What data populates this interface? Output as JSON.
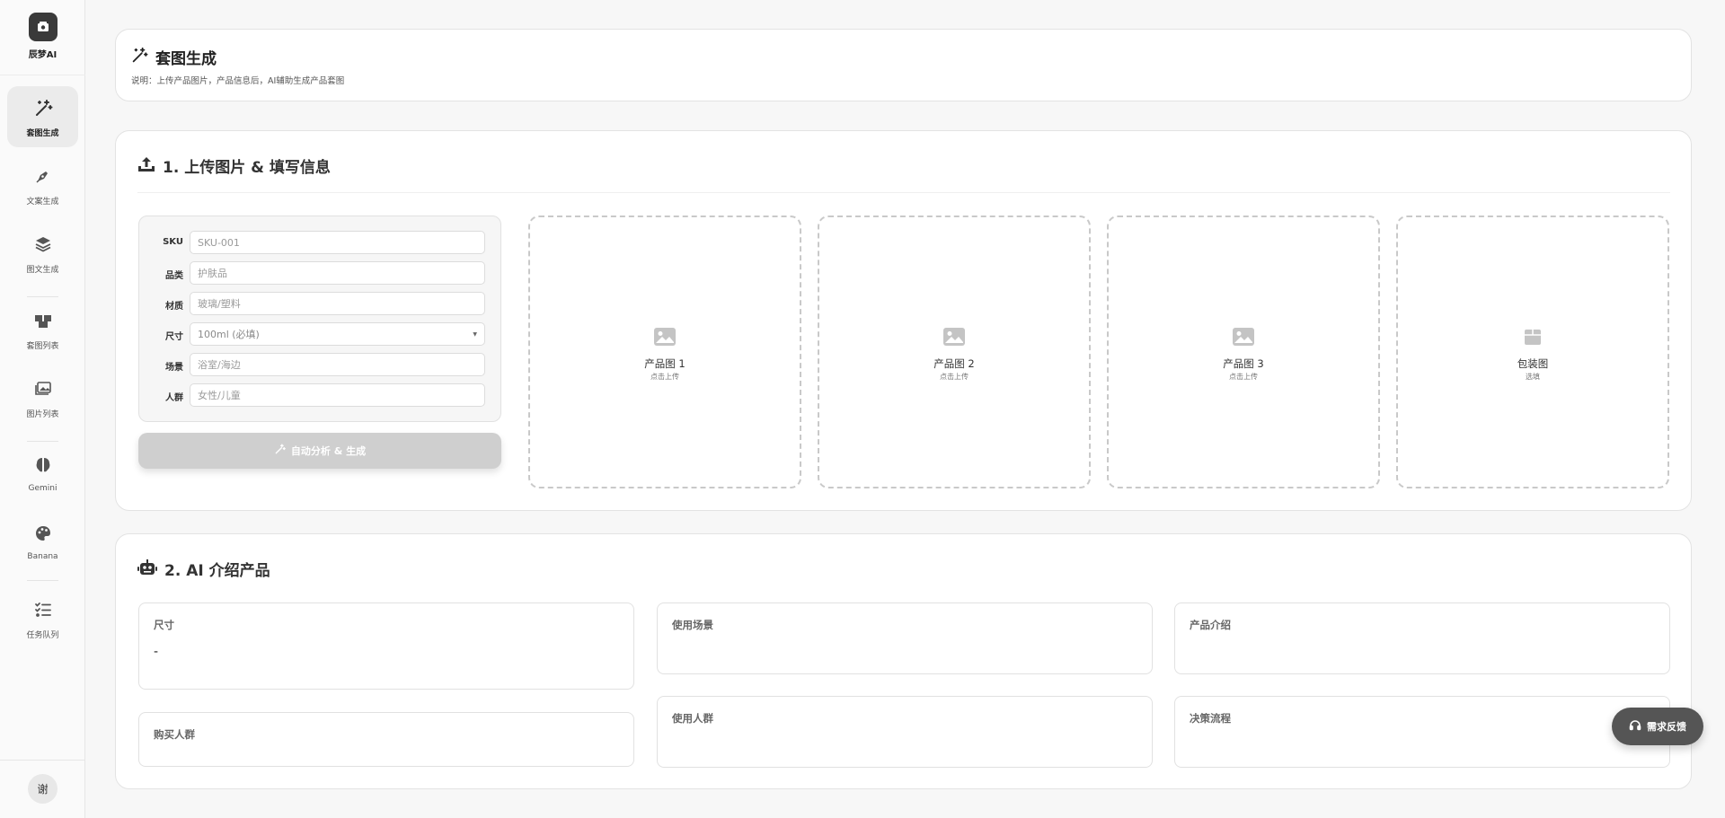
{
  "app": {
    "logo_text": "辰梦AI"
  },
  "sidebar": {
    "items": [
      {
        "label": "套图生成",
        "icon": "magic-wand-icon"
      },
      {
        "label": "文案生成",
        "icon": "pen-nib-icon"
      },
      {
        "label": "图文生成",
        "icon": "layers-icon"
      },
      {
        "label": "套图列表",
        "icon": "boxes-icon"
      },
      {
        "label": "图片列表",
        "icon": "images-icon"
      },
      {
        "label": "Gemini",
        "icon": "brain-icon"
      },
      {
        "label": "Banana",
        "icon": "palette-icon"
      },
      {
        "label": "任务队列",
        "icon": "task-list-icon"
      }
    ],
    "avatar_text": "谢"
  },
  "header": {
    "title": "套图生成",
    "description": "说明：上传产品图片，产品信息后，AI辅助生成产品套图"
  },
  "section1": {
    "title": "1. 上传图片 & 填写信息",
    "fields": [
      {
        "label": "SKU",
        "placeholder": "SKU-001"
      },
      {
        "label": "品类",
        "placeholder": "护肤品"
      },
      {
        "label": "材质",
        "placeholder": "玻璃/塑料"
      },
      {
        "label": "尺寸",
        "placeholder": "100ml (必填)"
      },
      {
        "label": "场景",
        "placeholder": "浴室/海边"
      },
      {
        "label": "人群",
        "placeholder": "女性/儿童"
      }
    ],
    "generate_button": "自动分析 & 生成",
    "uploads": [
      {
        "title": "产品图 1",
        "hint": "点击上传"
      },
      {
        "title": "产品图 2",
        "hint": "点击上传"
      },
      {
        "title": "产品图 3",
        "hint": "点击上传"
      },
      {
        "title": "包装图",
        "hint": "选填"
      }
    ]
  },
  "section2": {
    "title": "2. AI 介绍产品",
    "boxes": {
      "size": {
        "label": "尺寸",
        "value": "-"
      },
      "buyers": {
        "label": "购买人群"
      },
      "scene": {
        "label": "使用场景"
      },
      "users": {
        "label": "使用人群"
      },
      "intro": {
        "label": "产品介绍"
      },
      "decision": {
        "label": "决策流程"
      }
    }
  },
  "feedback_button": "需求反馈"
}
